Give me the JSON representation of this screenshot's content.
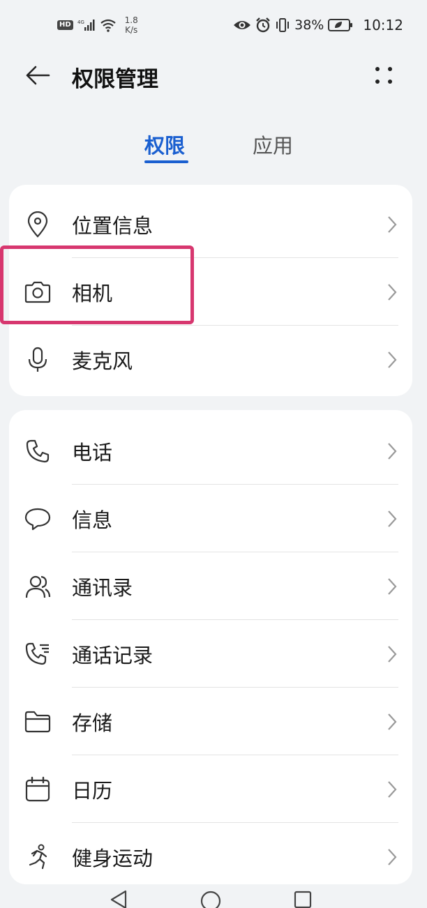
{
  "status_bar": {
    "hd": "HD",
    "network": "4G",
    "speed_value": "1.8",
    "speed_unit": "K/s",
    "battery": "38%",
    "time": "10:12"
  },
  "header": {
    "title": "权限管理"
  },
  "tabs": [
    {
      "label": "权限",
      "active": true
    },
    {
      "label": "应用",
      "active": false
    }
  ],
  "card1": [
    {
      "label": "位置信息",
      "icon": "location-pin-icon"
    },
    {
      "label": "相机",
      "icon": "camera-icon"
    },
    {
      "label": "麦克风",
      "icon": "microphone-icon"
    }
  ],
  "card2": [
    {
      "label": "电话",
      "icon": "phone-icon"
    },
    {
      "label": "信息",
      "icon": "message-bubble-icon"
    },
    {
      "label": "通讯录",
      "icon": "contacts-icon"
    },
    {
      "label": "通话记录",
      "icon": "call-log-icon"
    },
    {
      "label": "存储",
      "icon": "folder-icon"
    },
    {
      "label": "日历",
      "icon": "calendar-icon"
    },
    {
      "label": "健身运动",
      "icon": "running-icon"
    }
  ],
  "colors": {
    "accent": "#1a5fd0",
    "highlight": "#d7376f",
    "background": "#f1f3f5",
    "card": "#ffffff"
  }
}
